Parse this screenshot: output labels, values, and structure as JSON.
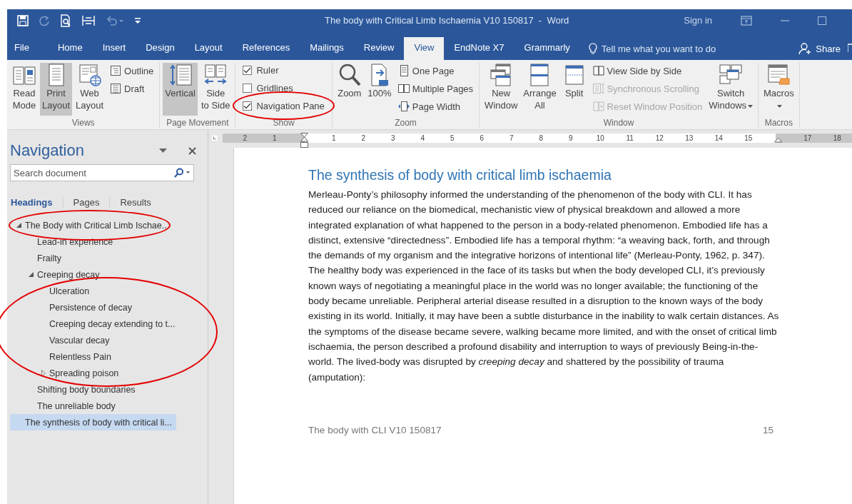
{
  "title_bar": {
    "title": "The body with Critical Limb Ischaemia V10 150817  -  Word",
    "sign_in": "Sign in"
  },
  "tabs": [
    {
      "label": "File",
      "selected": false
    },
    {
      "label": "Home",
      "selected": false
    },
    {
      "label": "Insert",
      "selected": false
    },
    {
      "label": "Design",
      "selected": false
    },
    {
      "label": "Layout",
      "selected": false
    },
    {
      "label": "References",
      "selected": false
    },
    {
      "label": "Mailings",
      "selected": false
    },
    {
      "label": "Review",
      "selected": false
    },
    {
      "label": "View",
      "selected": true
    },
    {
      "label": "EndNote X7",
      "selected": false
    },
    {
      "label": "Grammarly",
      "selected": false
    }
  ],
  "tell_me": {
    "placeholder": "Tell me what you want to do"
  },
  "share": "Share",
  "ribbon": {
    "groups": [
      {
        "name": "Views",
        "items": [
          {
            "kind": "large",
            "label": [
              "Read",
              "Mode"
            ],
            "selected": false
          },
          {
            "kind": "large",
            "label": [
              "Print",
              "Layout"
            ],
            "selected": true
          },
          {
            "kind": "large",
            "label": [
              "Web",
              "Layout"
            ],
            "selected": false
          },
          {
            "kind": "stack",
            "items": [
              {
                "label": "Outline",
                "disabled": false
              },
              {
                "label": "Draft",
                "disabled": false
              }
            ]
          }
        ]
      },
      {
        "name": "Page Movement",
        "items": [
          {
            "kind": "large",
            "label": [
              "Vertical"
            ],
            "selected": true
          },
          {
            "kind": "large",
            "label": [
              "Side",
              "to Side"
            ],
            "selected": false
          }
        ]
      },
      {
        "name": "Show",
        "items": [
          {
            "kind": "checks",
            "items": [
              {
                "label": "Ruler",
                "checked": true,
                "circled": false
              },
              {
                "label": "Gridlines",
                "checked": false,
                "circled": false
              },
              {
                "label": "Navigation Pane",
                "checked": true,
                "circled": true
              }
            ]
          }
        ]
      },
      {
        "name": "Zoom",
        "items": [
          {
            "kind": "large",
            "label": [
              "Zoom"
            ],
            "selected": false
          },
          {
            "kind": "large",
            "label": [
              "100%"
            ],
            "selected": false
          },
          {
            "kind": "stack",
            "items": [
              {
                "label": "One Page",
                "disabled": false
              },
              {
                "label": "Multiple Pages",
                "disabled": false
              },
              {
                "label": "Page Width",
                "disabled": false
              }
            ]
          }
        ]
      },
      {
        "name": "Window",
        "items": [
          {
            "kind": "large",
            "label": [
              "New",
              "Window"
            ],
            "selected": false
          },
          {
            "kind": "large",
            "label": [
              "Arrange",
              "All"
            ],
            "selected": false
          },
          {
            "kind": "large",
            "label": [
              "Split"
            ],
            "selected": false
          },
          {
            "kind": "stack",
            "items": [
              {
                "label": "View Side by Side",
                "disabled": false
              },
              {
                "label": "Synchronous Scrolling",
                "disabled": true
              },
              {
                "label": "Reset Window Position",
                "disabled": true
              }
            ]
          },
          {
            "kind": "large",
            "label": [
              "Switch",
              "Windows"
            ],
            "selected": false,
            "dropdown": true
          }
        ]
      },
      {
        "name": "Macros",
        "items": [
          {
            "kind": "large",
            "label": [
              "Macros"
            ],
            "selected": false,
            "dropdown": true
          }
        ]
      }
    ]
  },
  "navigation": {
    "title": "Navigation",
    "search": {
      "placeholder": "Search document"
    },
    "tabs": [
      {
        "label": "Headings",
        "selected": true
      },
      {
        "label": "Pages",
        "selected": false
      },
      {
        "label": "Results",
        "selected": false
      }
    ],
    "headings": [
      {
        "label": "The Body with Critical Limb Ischae...",
        "selected": false,
        "expanded": true,
        "circled": true,
        "children_circled": false,
        "children": [
          {
            "label": "Lead-in experience",
            "selected": false,
            "circled": false
          },
          {
            "label": "Frailty",
            "selected": false,
            "circled": false
          },
          {
            "label": "Creeping decay",
            "selected": false,
            "expanded": true,
            "circled": false,
            "children_circled": true,
            "children": [
              {
                "label": "Ulceration",
                "selected": false,
                "circled": false
              },
              {
                "label": "Persistence of decay",
                "selected": false,
                "circled": false
              },
              {
                "label": "Creeping decay extending to t...",
                "selected": false,
                "circled": false
              },
              {
                "label": "Vascular decay",
                "selected": false,
                "circled": false
              },
              {
                "label": "Relentless Pain",
                "selected": false,
                "circled": false
              },
              {
                "label": "Spreading poison",
                "selected": false,
                "expanded": false,
                "circled": false
              }
            ]
          },
          {
            "label": "Shifting body boundaries",
            "selected": false,
            "circled": false
          },
          {
            "label": "The unreliable body",
            "selected": false,
            "circled": false
          }
        ]
      },
      {
        "label": "The synthesis of body with critical li...",
        "selected": true,
        "circled": false
      }
    ]
  },
  "ruler": {
    "ticks": [
      {
        "kind": "number",
        "label": "2"
      },
      {
        "kind": "number",
        "label": "1"
      },
      {
        "kind": "left-indent"
      },
      {
        "kind": "number",
        "label": "1"
      },
      {
        "kind": "number",
        "label": "2"
      },
      {
        "kind": "number",
        "label": "3"
      },
      {
        "kind": "number",
        "label": "4"
      },
      {
        "kind": "number",
        "label": "5"
      },
      {
        "kind": "number",
        "label": "6"
      },
      {
        "kind": "number",
        "label": "7"
      },
      {
        "kind": "number",
        "label": "8"
      },
      {
        "kind": "number",
        "label": "9"
      },
      {
        "kind": "number",
        "label": "10"
      },
      {
        "kind": "number",
        "label": "11"
      },
      {
        "kind": "number",
        "label": "12"
      },
      {
        "kind": "number",
        "label": "13"
      },
      {
        "kind": "number",
        "label": "14"
      },
      {
        "kind": "number",
        "label": "15"
      },
      {
        "kind": "right-indent"
      },
      {
        "kind": "number",
        "label": "17"
      },
      {
        "kind": "number",
        "label": "18"
      }
    ]
  },
  "document": {
    "heading": "The synthesis of body with critical limb ischaemia",
    "paragraph": "Merleau-Ponty’s philosophy informed the understanding of the phenomenon of the body with CLI. It has reduced our reliance on the biomedical, mechanistic view of physical breakdown and allowed a more integrated explanation of what happened to the person in a body-related phenomenon. Embodied life has a distinct, extensive “directedness”. Embodied life has a temporal rhythm: “a weaving back, forth, and through the demands of my organism and the integrative horizons of intentional life” (Merleau-Ponty, 1962, p. 347). The healthy body was experienced in the face of its tasks but when the body developed CLI, it’s previously known ways of negotiating a meaningful place in the world was no longer available; the functioning of the body became unreliable. Peripheral arterial disease resulted in a disruption to the known ways of the body existing in its world. Initially, it may have been a subtle disturbance in the inability to walk certain distances. As the symptoms of the disease became severe, walking became more limited, and with the onset of critical limb ischaemia, the person described a profound disability and interruption to ways of previously Being-in-the-world. The lived-body was disrupted by *creeping decay* and shattered by the possibility of trauma (amputation):",
    "footer": {
      "text": "The body with CLI V10 150817",
      "page_number": "15"
    }
  }
}
